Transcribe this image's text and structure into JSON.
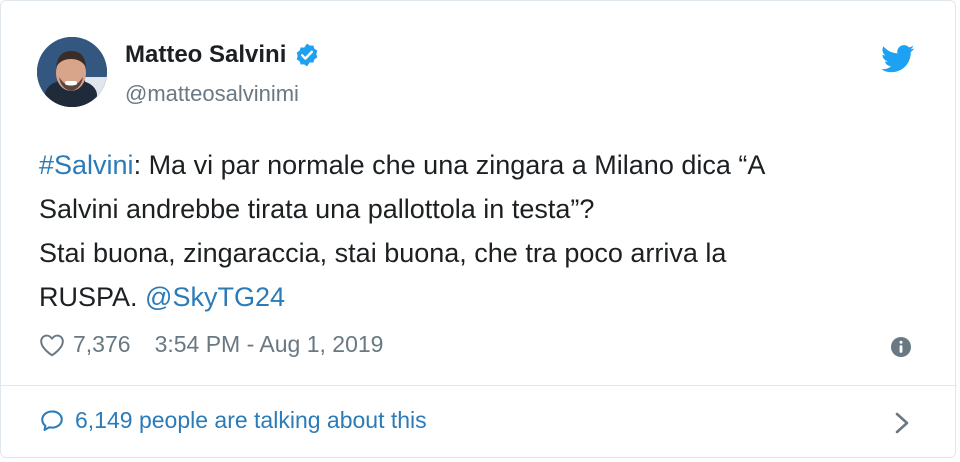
{
  "user": {
    "name": "Matteo Salvini",
    "handle": "@matteosalvinimi"
  },
  "tweet": {
    "hashtag": "#Salvini",
    "line1_rest": ": Ma vi par normale che una zingara a Milano dica “A",
    "line2": "Salvini andrebbe tirata una pallottola in testa”?",
    "line3": "Stai buona, zingaraccia, stai buona, che tra poco arriva la",
    "line4_text": "RUSPA. ",
    "mention": "@SkyTG24"
  },
  "meta": {
    "likes": "7,376",
    "timestamp": "3:54 PM - Aug 1, 2019"
  },
  "footer": {
    "talking": "6,149 people are talking about this"
  },
  "colors": {
    "link": "#2b7bb9",
    "secondary_text": "#697882",
    "verified": "#1da1f2",
    "twitter_bird": "#1da1f2"
  },
  "icons": [
    "verified-badge-icon",
    "twitter-bird-icon",
    "heart-icon",
    "info-icon",
    "speech-bubble-icon",
    "chevron-right-icon"
  ]
}
